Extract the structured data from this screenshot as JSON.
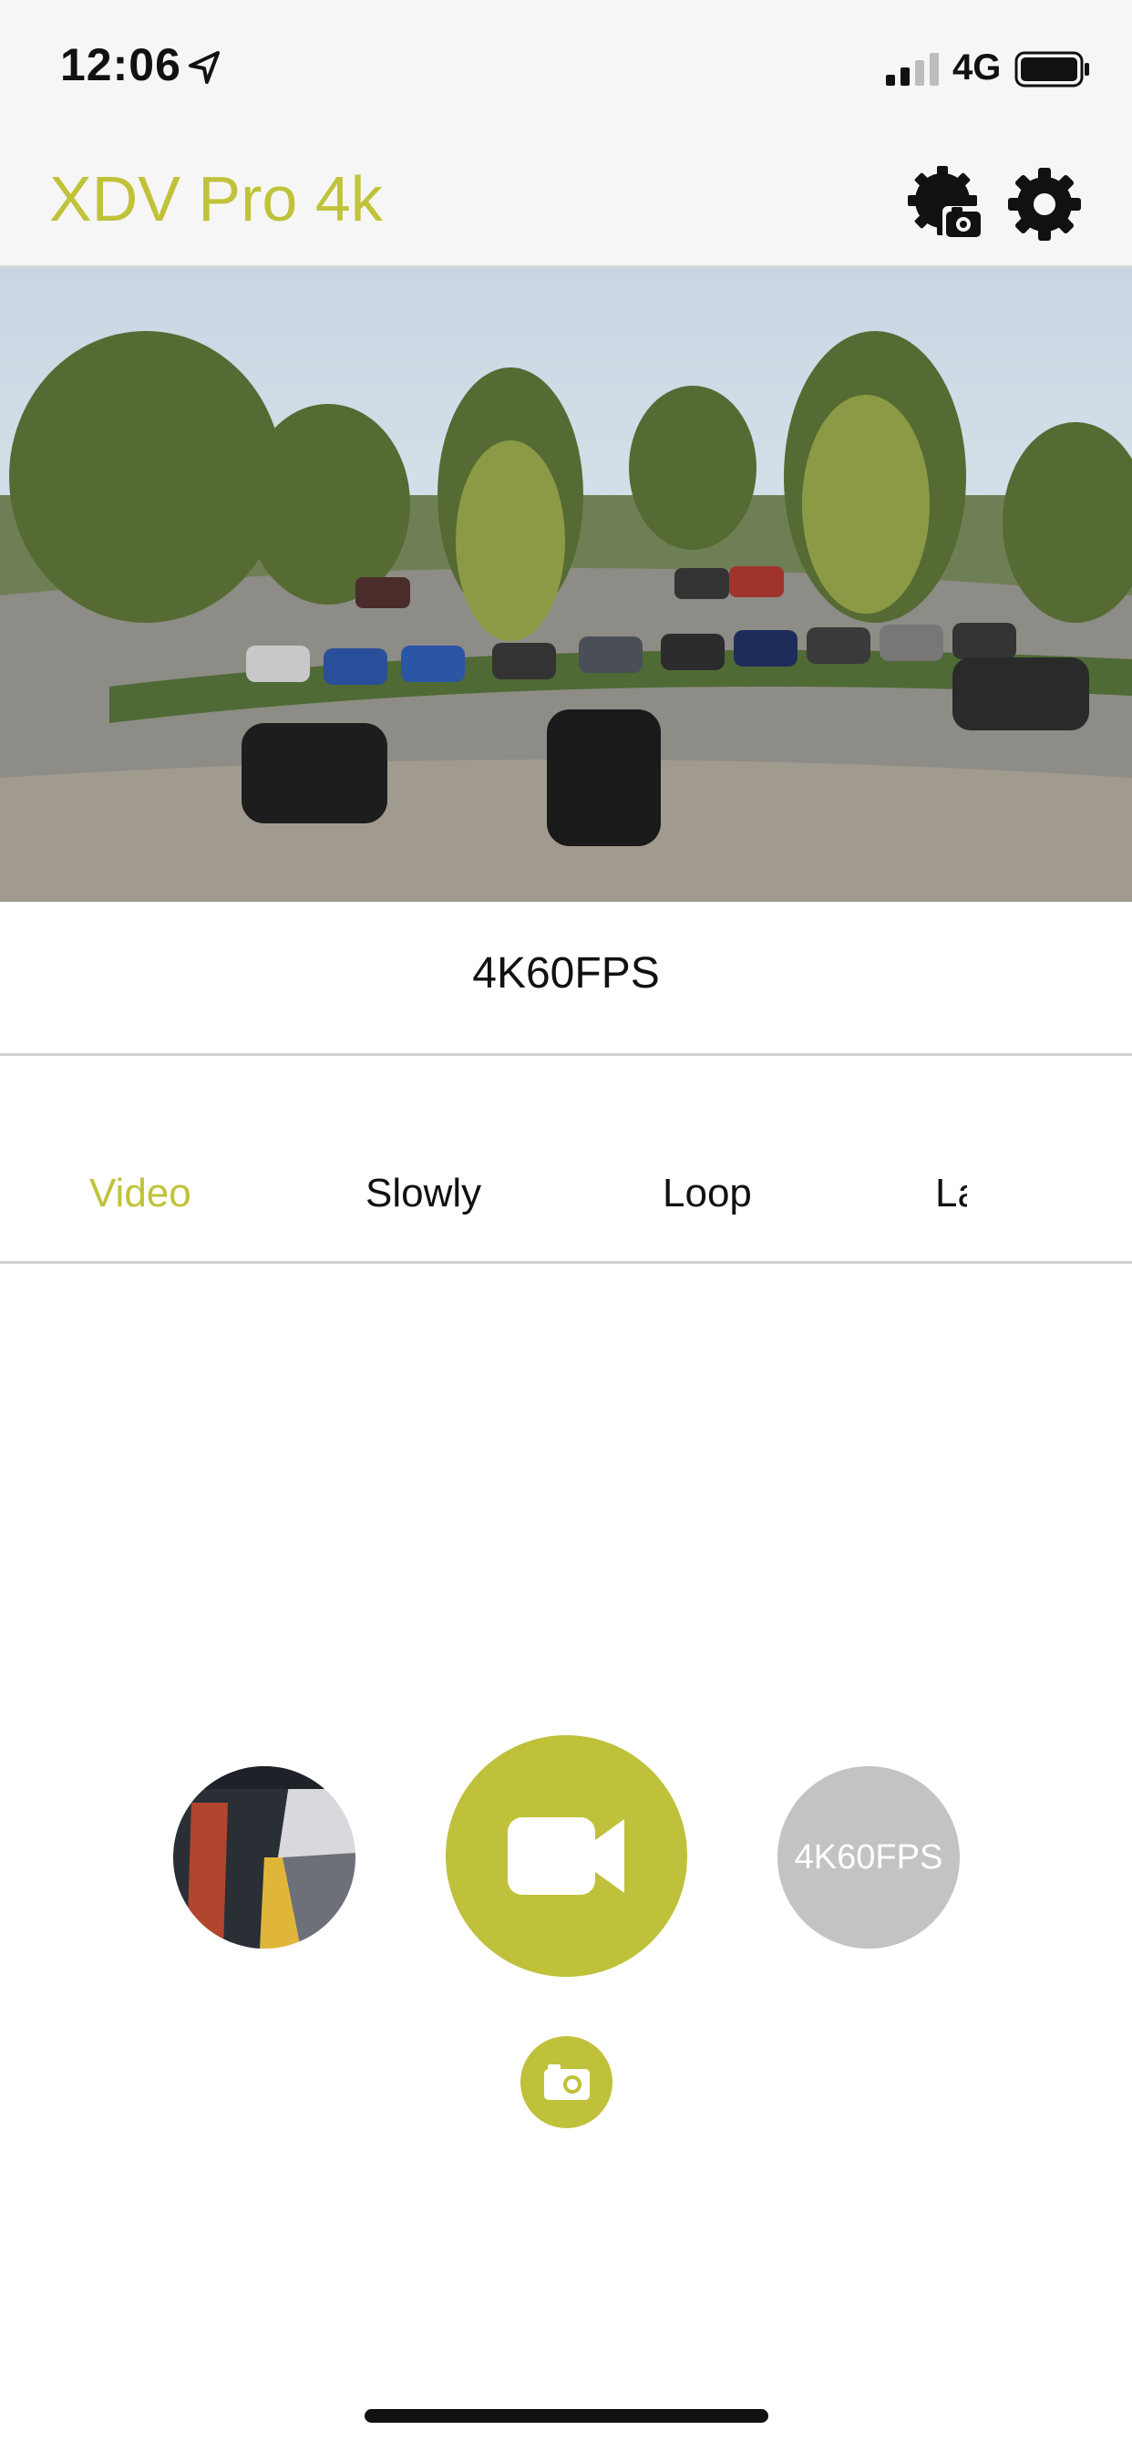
{
  "status_bar": {
    "time": "12:06",
    "network": "4G"
  },
  "header": {
    "title": "XDV Pro 4k"
  },
  "preview": {
    "resolution_label": "4K60FPS"
  },
  "modes": {
    "items": [
      {
        "label": "Video",
        "active": true
      },
      {
        "label": "Slowly",
        "active": false
      },
      {
        "label": "Loop",
        "active": false
      },
      {
        "label": "La",
        "active": false
      }
    ]
  },
  "controls": {
    "resolution_button_label": "4K60FPS"
  },
  "colors": {
    "accent": "#bfc13a",
    "inactive": "#c3c3c3",
    "header_bg": "#f7f6f6"
  },
  "icons": {
    "location": "location-arrow-icon",
    "camera_settings": "camera-gear-icon",
    "settings": "gear-icon",
    "record": "video-camera-icon",
    "photo": "photo-camera-icon"
  }
}
